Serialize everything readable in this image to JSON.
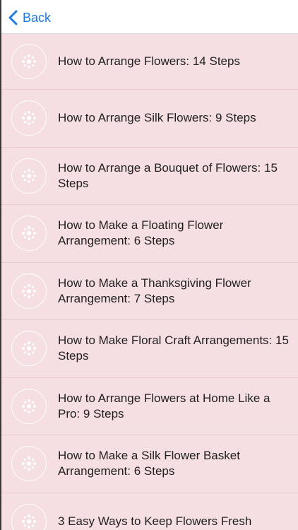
{
  "navbar": {
    "back_label": "Back"
  },
  "items": [
    {
      "title": "How to Arrange Flowers: 14 Steps"
    },
    {
      "title": "How to Arrange Silk Flowers: 9 Steps"
    },
    {
      "title": "How to Arrange a Bouquet of Flowers: 15 Steps"
    },
    {
      "title": "How to Make a Floating Flower Arrangement: 6 Steps"
    },
    {
      "title": "How to Make a Thanksgiving Flower Arrangement: 7 Steps"
    },
    {
      "title": "How to Make Floral Craft Arrangements: 15 Steps"
    },
    {
      "title": "How to Arrange Flowers at Home Like a Pro: 9 Steps"
    },
    {
      "title": "How to Make a Silk Flower Basket Arrangement: 6 Steps"
    },
    {
      "title": "3 Easy Ways to Keep Flowers Fresh"
    }
  ],
  "icons": {
    "back": "chevron-left-icon",
    "thumb": "flower-icon"
  },
  "colors": {
    "accent": "#1a7cf5",
    "background": "#f5dfe3",
    "navbar": "#ffffff",
    "text": "#1f1f1f"
  }
}
